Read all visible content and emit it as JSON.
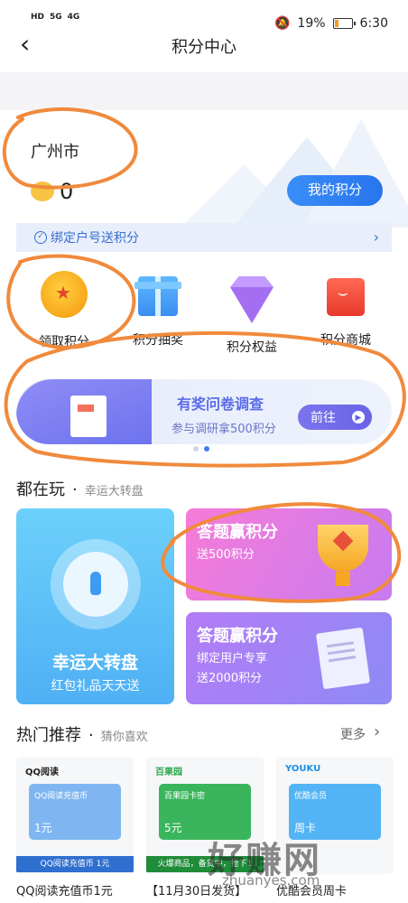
{
  "status_bar": {
    "left": [
      "HD",
      "5G",
      "4G"
    ],
    "battery": "19%",
    "time": "6:30"
  },
  "nav": {
    "back_icon": "chevron-left",
    "title": "积分中心"
  },
  "header": {
    "city": "广州市",
    "points": "0",
    "my_points_button": "我的积分"
  },
  "bind_banner": {
    "text": "绑定户号送积分"
  },
  "quick_actions": [
    {
      "label": "领取积分",
      "icon": "coin-star"
    },
    {
      "label": "积分抽奖",
      "icon": "gift-box"
    },
    {
      "label": "积分权益",
      "icon": "diamond"
    },
    {
      "label": "积分商城",
      "icon": "shopping-bag"
    }
  ],
  "survey_banner": {
    "title": "有奖问卷调查",
    "subtitle": "参与调研拿500积分",
    "button": "前往"
  },
  "playing_section": {
    "title": "都在玩",
    "subtitle": "幸运大转盘"
  },
  "wheel_card": {
    "title": "幸运大转盘",
    "subtitle": "红包礼品天天送"
  },
  "quiz_card_1": {
    "title": "答题赢积分",
    "line1": "送500积分"
  },
  "quiz_card_2": {
    "title": "答题赢积分",
    "line1": "绑定用户专享",
    "line2": "送2000积分"
  },
  "hot_section": {
    "title": "热门推荐",
    "subtitle": "猜你喜欢",
    "more": "更多"
  },
  "products": [
    {
      "brand": "QQ阅读",
      "face_title": "QQ阅读充值币",
      "face_value": "1元",
      "strip": "QQ阅读充值币 1元",
      "name": "QQ阅读充值币1元",
      "color": "#3a78d8"
    },
    {
      "brand": "百果园",
      "face_title": "百果园卡密",
      "face_value": "5元",
      "strip": "火爆商品，备货中，抢下1",
      "name": "【11月30日发货】",
      "color": "#2ba84a"
    },
    {
      "brand": "YOUKU",
      "face_title": "优酷会员",
      "face_value": "周卡",
      "strip": "",
      "name": "优酷会员周卡",
      "color": "#39a6f0"
    }
  ],
  "watermark": {
    "text": "好赚网",
    "url": "zhuanyes.com"
  }
}
